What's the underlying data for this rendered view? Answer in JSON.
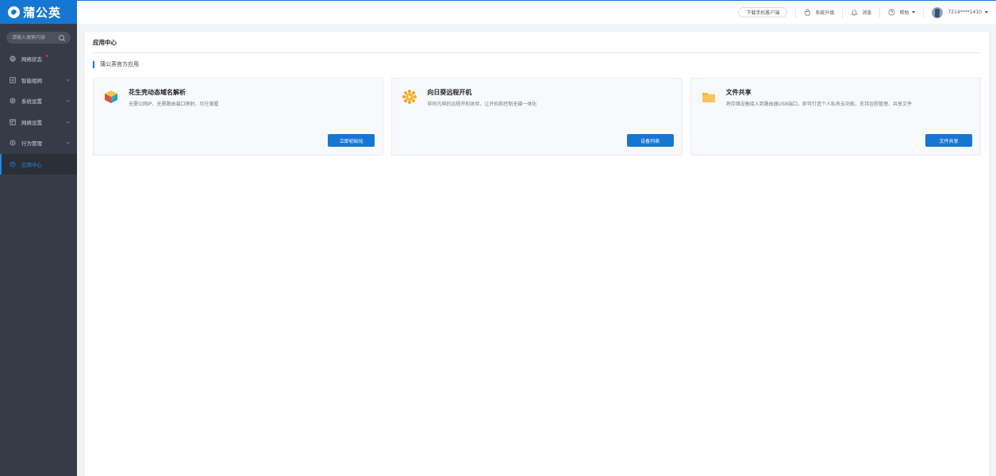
{
  "brand": {
    "name": "蒲公英",
    "accent": "#1677d2"
  },
  "sidebar": {
    "search_placeholder": "请输入搜索内容",
    "items": [
      {
        "label": "网络状态",
        "icon": "globe-icon",
        "has_alert": true,
        "expandable": false,
        "active": false
      },
      {
        "label": "智能组网",
        "icon": "network-icon",
        "expandable": true,
        "active": false
      },
      {
        "label": "系统设置",
        "icon": "gear-icon",
        "expandable": true,
        "active": false
      },
      {
        "label": "网络设置",
        "icon": "layout-icon",
        "expandable": true,
        "active": false
      },
      {
        "label": "行为管理",
        "icon": "shield-icon",
        "expandable": true,
        "active": false
      },
      {
        "label": "应用中心",
        "icon": "apps-icon",
        "expandable": false,
        "active": true
      }
    ]
  },
  "topbar": {
    "download_client": "下载手机客户端",
    "upgrade": "系统升级",
    "messages": "消息",
    "help": "帮助",
    "account": "7214****1410"
  },
  "main": {
    "title": "应用中心",
    "section_title": "蒲公英官方应用",
    "cards": [
      {
        "title": "花生壳动态域名解析",
        "desc": "无需公网IP、无需路由端口映射，尽在掌握",
        "button": "立即初始化",
        "icon": "cube-icon"
      },
      {
        "title": "向日葵远程开机",
        "desc": "非同凡响的远程开机体验，让开机和控制无缝一体化",
        "button": "设备列表",
        "icon": "sunflower-icon"
      },
      {
        "title": "文件共享",
        "desc": "将存储设备接入到路由器USB端口，即可打造个人私有云功能，支持远程管理、共享文件",
        "button": "文件共享",
        "icon": "folder-icon"
      }
    ]
  }
}
